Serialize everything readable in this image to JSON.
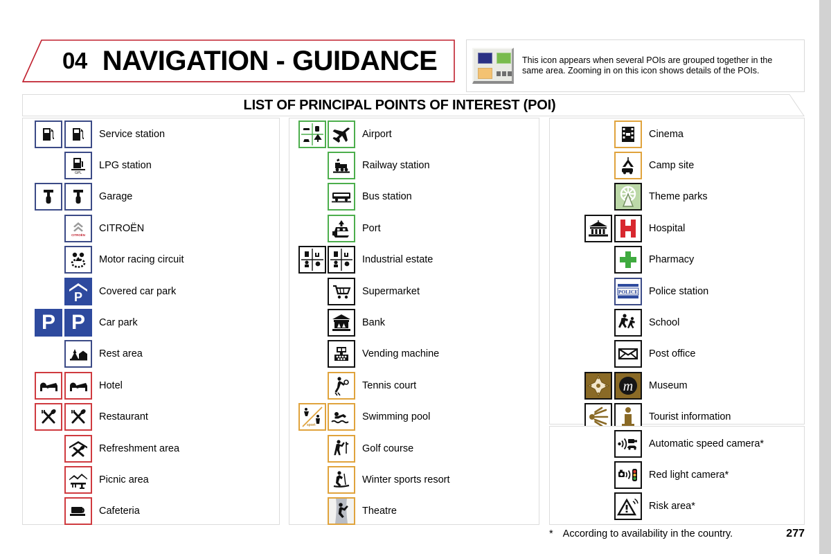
{
  "header": {
    "chapter_number": "04",
    "chapter_title": "NAVIGATION - GUIDANCE",
    "info_icon_name": "grouped-poi-icon",
    "info_text": "This icon appears when several POIs are grouped together in the same area. Zooming in on this icon shows details of the POIs.",
    "info_icon_colors": {
      "blue": "#2b3184",
      "green": "#79bb4d",
      "orange": "#f3c272",
      "dots": "#6f6f6f",
      "panel": "#e9eae4"
    }
  },
  "section": {
    "title": "LIST OF PRINCIPAL POINTS OF INTEREST (POI)"
  },
  "columns": [
    {
      "id": "column-1",
      "items": [
        {
          "label": "Service station",
          "icons": [
            "fuel-pump-icon",
            "fuel-pump-icon"
          ],
          "border": "blue"
        },
        {
          "label": "LPG station",
          "icons": [
            null,
            "lpg-pump-icon"
          ],
          "border": "blue"
        },
        {
          "label": "Garage",
          "icons": [
            "spanner-icon",
            "spanner-icon"
          ],
          "border": "blue"
        },
        {
          "label": "CITROËN",
          "icons": [
            null,
            "citroen-logo-icon"
          ],
          "border": "blue"
        },
        {
          "label": "Motor racing circuit",
          "icons": [
            null,
            "race-circuit-icon"
          ],
          "border": "blue"
        },
        {
          "label": "Covered car park",
          "icons": [
            null,
            "covered-parking-icon"
          ],
          "border": "blue-filled"
        },
        {
          "label": "Car park",
          "icons": [
            "parking-icon",
            "parking-icon"
          ],
          "border": "blue-filled"
        },
        {
          "label": "Rest area",
          "icons": [
            null,
            "rest-area-icon"
          ],
          "border": "blue"
        },
        {
          "label": "Hotel",
          "icons": [
            "bed-icon",
            "bed-icon"
          ],
          "border": "red"
        },
        {
          "label": "Restaurant",
          "icons": [
            "cutlery-icon",
            "cutlery-icon"
          ],
          "border": "red"
        },
        {
          "label": "Refreshment area",
          "icons": [
            null,
            "refreshment-icon"
          ],
          "border": "red"
        },
        {
          "label": "Picnic area",
          "icons": [
            null,
            "picnic-table-icon"
          ],
          "border": "red"
        },
        {
          "label": "Cafeteria",
          "icons": [
            null,
            "coffee-cup-icon"
          ],
          "border": "red"
        }
      ]
    },
    {
      "id": "column-2",
      "items": [
        {
          "label": "Airport",
          "icons": [
            "transport-group-icon",
            "airplane-icon"
          ],
          "border": "green"
        },
        {
          "label": "Railway station",
          "icons": [
            null,
            "train-icon"
          ],
          "border": "green"
        },
        {
          "label": "Bus station",
          "icons": [
            null,
            "bus-icon"
          ],
          "border": "green"
        },
        {
          "label": "Port",
          "icons": [
            null,
            "ship-icon"
          ],
          "border": "green"
        },
        {
          "label": "Industrial estate",
          "icons": [
            "industry-grid-icon",
            "industry-grid-icon"
          ],
          "border": "black"
        },
        {
          "label": "Supermarket",
          "icons": [
            null,
            "shopping-trolley-icon"
          ],
          "border": "black"
        },
        {
          "label": "Bank",
          "icons": [
            null,
            "bank-building-icon"
          ],
          "border": "black"
        },
        {
          "label": "Vending machine",
          "icons": [
            null,
            "vending-machine-icon"
          ],
          "border": "black"
        },
        {
          "label": "Tennis court",
          "icons": [
            null,
            "tennis-player-icon"
          ],
          "border": "orange"
        },
        {
          "label": "Swimming pool",
          "icons": [
            "sport-group-icon",
            "swimmer-icon"
          ],
          "border": "orange"
        },
        {
          "label": "Golf course",
          "icons": [
            null,
            "golfer-icon"
          ],
          "border": "orange"
        },
        {
          "label": "Winter sports resort",
          "icons": [
            null,
            "skier-icon"
          ],
          "border": "orange"
        },
        {
          "label": "Theatre",
          "icons": [
            null,
            "theatre-icon"
          ],
          "border": "orange"
        }
      ]
    },
    {
      "id": "column-3",
      "items": [
        {
          "label": "Cinema",
          "icons": [
            null,
            "film-reel-icon"
          ],
          "border": "orange"
        },
        {
          "label": "Camp site",
          "icons": [
            null,
            "tent-caravan-icon"
          ],
          "border": "orange"
        },
        {
          "label": "Theme parks",
          "icons": [
            null,
            "ferris-wheel-icon"
          ],
          "border": "green-filled"
        },
        {
          "label": "Hospital",
          "icons": [
            "temple-icon",
            "hospital-h-icon"
          ],
          "border": "black"
        },
        {
          "label": "Pharmacy",
          "icons": [
            null,
            "green-cross-icon"
          ],
          "border": "black"
        },
        {
          "label": "Police station",
          "icons": [
            null,
            "police-sign-icon"
          ],
          "border": "blue"
        },
        {
          "label": "School",
          "icons": [
            null,
            "children-crossing-icon"
          ],
          "border": "black"
        },
        {
          "label": "Post office",
          "icons": [
            null,
            "envelope-icon"
          ],
          "border": "black"
        },
        {
          "label": "Museum",
          "icons": [
            "compass-rose-icon",
            "museum-m-icon"
          ],
          "border": "brown"
        },
        {
          "label": "Tourist information",
          "icons": [
            "info-burst-icon",
            "info-i-icon"
          ],
          "border": "brown"
        }
      ]
    },
    {
      "id": "column-3b",
      "items": [
        {
          "label": "Automatic speed camera*",
          "icons": [
            null,
            "speed-camera-icon"
          ],
          "border": "black"
        },
        {
          "label": "Red light camera*",
          "icons": [
            null,
            "red-light-camera-icon"
          ],
          "border": "black"
        },
        {
          "label": "Risk area*",
          "icons": [
            null,
            "risk-warning-icon"
          ],
          "border": "black"
        }
      ]
    }
  ],
  "footer": {
    "asterisk": "*",
    "footnote": "According to availability in the country.",
    "page_number": "277"
  }
}
